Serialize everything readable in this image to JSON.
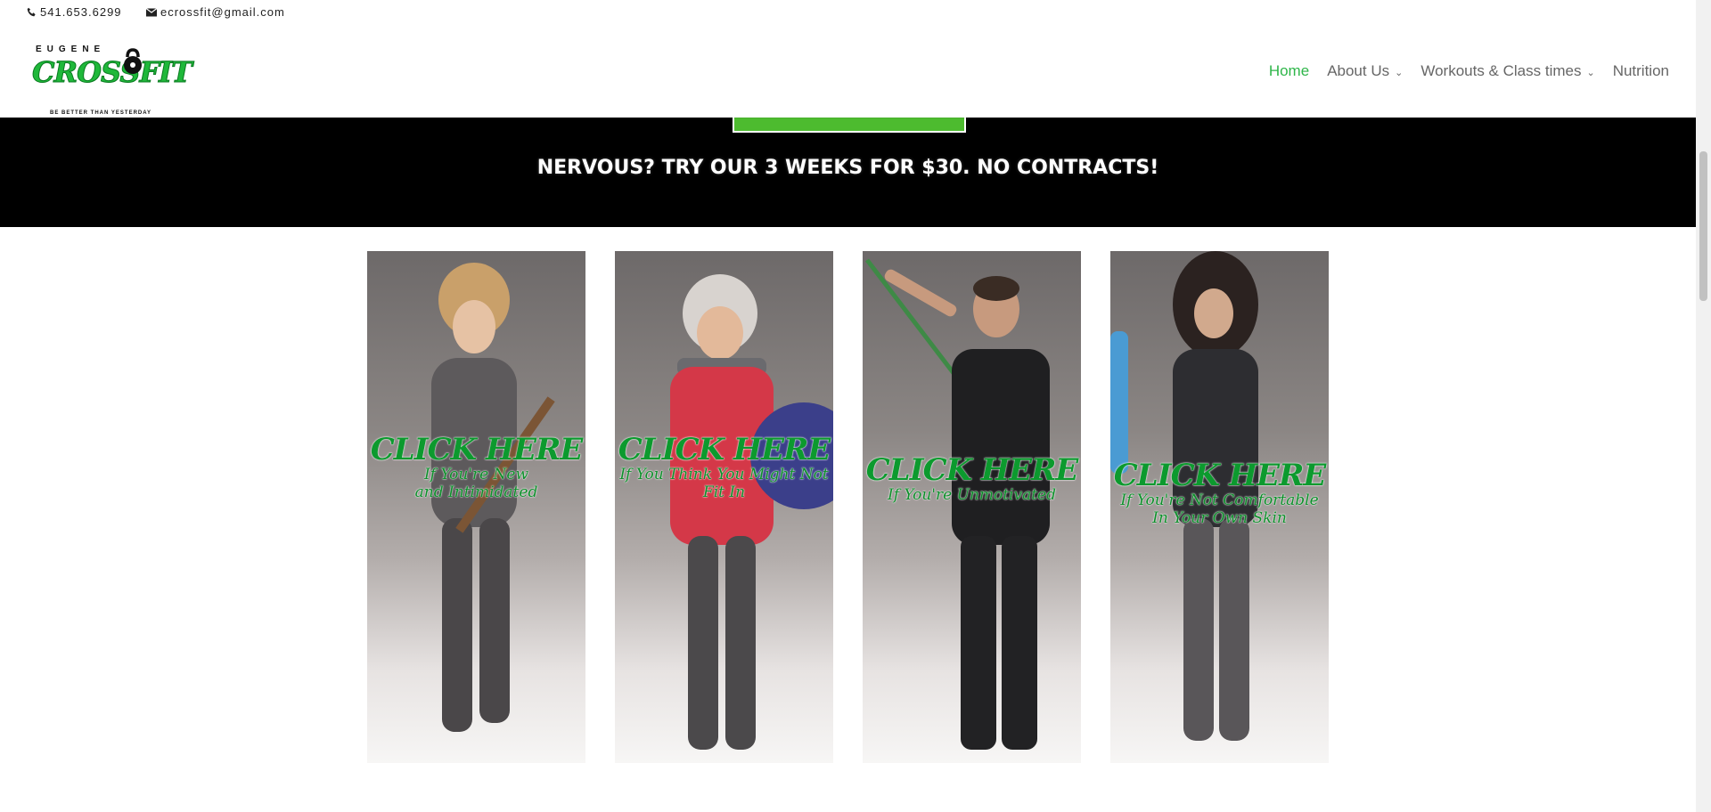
{
  "topbar": {
    "phone": "541.653.6299",
    "email": "ecrossfit@gmail.com"
  },
  "logo": {
    "line1": "EUGENE",
    "line2": "CROSSFIT",
    "tagline": "BE BETTER THAN YESTERDAY"
  },
  "nav": {
    "items": [
      {
        "label": "Home",
        "active": true,
        "has_submenu": false
      },
      {
        "label": "About Us",
        "active": false,
        "has_submenu": true
      },
      {
        "label": "Workouts & Class times",
        "active": false,
        "has_submenu": true
      },
      {
        "label": "Nutrition",
        "active": false,
        "has_submenu": false
      }
    ]
  },
  "banner": {
    "headline": "NERVOUS? TRY OUR 3 WEEKS FOR $30. NO CONTRACTS!"
  },
  "cards": [
    {
      "title": "CLICK HERE",
      "line1": "If You're New",
      "line2": "and Intimidated"
    },
    {
      "title": "CLICK HERE",
      "line1": "If You Think You Might Not",
      "line2": "Fit In"
    },
    {
      "title": "CLICK HERE",
      "line1": "If You're Unmotivated",
      "line2": ""
    },
    {
      "title": "CLICK HERE",
      "line1": "If You're Not Comfortable",
      "line2": "In Your Own Skin"
    }
  ],
  "colors": {
    "accent": "#2fb64a",
    "banner_bg": "#000000",
    "overlay_text": "#0c9a2e",
    "cta_green": "#4dbb2f"
  },
  "icons": {
    "phone": "phone-icon",
    "email": "envelope-icon",
    "submenu": "chevron-down-icon"
  }
}
